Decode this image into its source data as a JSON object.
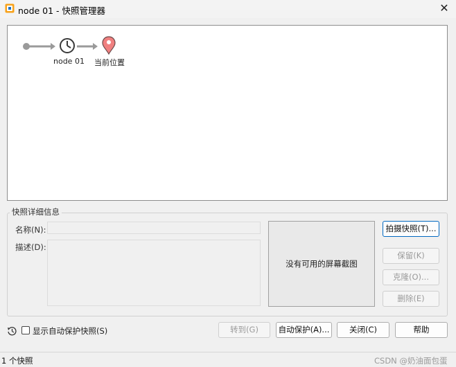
{
  "window": {
    "title": "node  01 - 快照管理器"
  },
  "timeline": {
    "snapshot_label": "node 01",
    "current_label": "当前位置"
  },
  "details": {
    "group_title": "快照详细信息",
    "name_label": "名称(N):",
    "desc_label": "描述(D):",
    "name_value": "",
    "desc_value": "",
    "no_screenshot": "没有可用的屏幕截图"
  },
  "side_buttons": {
    "take": "拍摄快照(T)...",
    "keep": "保留(K)",
    "clone": "克隆(O)...",
    "delete": "删除(E)"
  },
  "footer": {
    "show_autoprotect": "显示自动保护快照(S)",
    "goto": "转到(G)",
    "autoprotect": "自动保护(A)...",
    "close": "关闭(C)",
    "help": "帮助"
  },
  "status": {
    "count": "1 个快照",
    "watermark": "CSDN @奶油面包蛋"
  },
  "colors": {
    "pin": "#f08080",
    "timeline_gray": "#9a9a9a",
    "accent": "#0067c0"
  }
}
